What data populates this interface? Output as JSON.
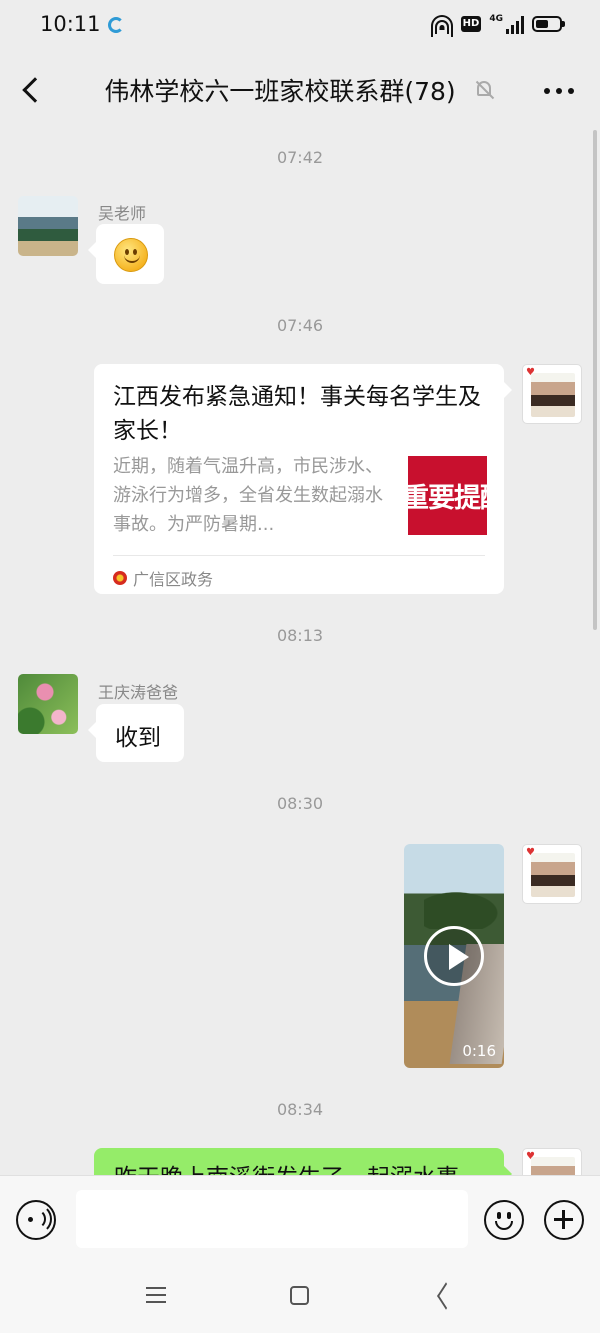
{
  "status_bar": {
    "time": "10:11",
    "hd": "HD",
    "network": "4G"
  },
  "header": {
    "title": "伟林学校六一班家校联系群(78)"
  },
  "messages": {
    "ts1": "07:42",
    "msg1": {
      "sender": "吴老师"
    },
    "ts2": "07:46",
    "msg2": {
      "title": "江西发布紧急通知！事关每名学生及家长！",
      "desc": "近期，随着气温升高，市民涉水、游泳行为增多，全省发生数起溺水事故。为严防暑期...",
      "thumb_text": "重要提醒",
      "source": "广信区政务"
    },
    "ts3": "08:13",
    "msg3": {
      "sender": "王庆涛爸爸",
      "text": "收到"
    },
    "ts4": "08:30",
    "msg4": {
      "duration": "0:16"
    },
    "ts5": "08:34",
    "msg5": {
      "text": "昨天晚上南溪街发生了一起溺水事"
    }
  },
  "colors": {
    "bg": "#ededed",
    "bubble_green": "#95ec69",
    "bubble_white": "#ffffff"
  }
}
